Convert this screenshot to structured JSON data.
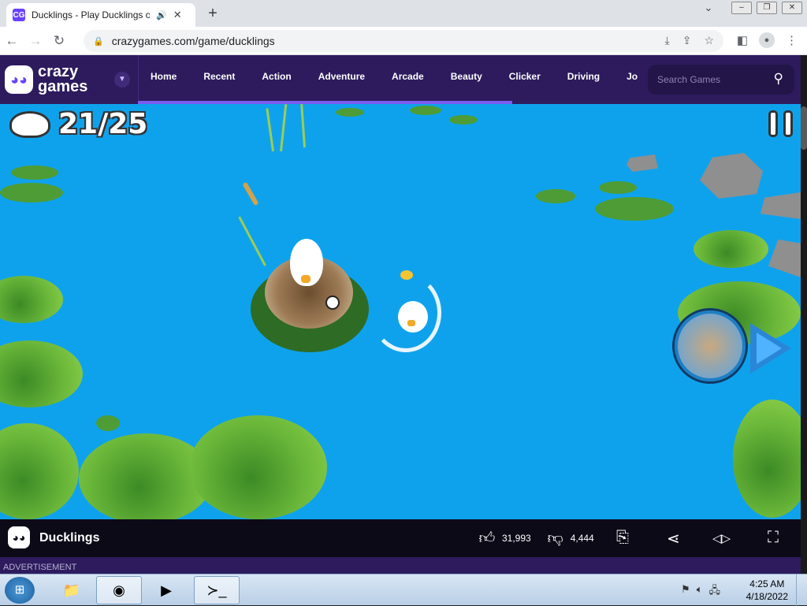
{
  "browser": {
    "tab_title": "Ducklings - Play Ducklings o",
    "tab_favicon": "CG",
    "tab_audio_icon": "speaker-icon",
    "tab_close": "✕",
    "new_tab": "+",
    "url": "crazygames.com/game/ducklings"
  },
  "site": {
    "logo_line1": "crazy",
    "logo_line2": "games",
    "nav": [
      "Home",
      "Recent",
      "Action",
      "Adventure",
      "Arcade",
      "Beauty",
      "Clicker",
      "Driving",
      "Jo"
    ],
    "search_placeholder": "Search Games",
    "colors": {
      "header_bg": "#2d1b5e",
      "accent": "#6842ff"
    }
  },
  "game": {
    "ducklings_count": "21/25",
    "water_color": "#0fa2ec"
  },
  "footer": {
    "title": "Ducklings",
    "likes": "31,993",
    "dislikes": "4,444",
    "advertisement": "ADVERTISEMENT"
  },
  "taskbar": {
    "time": "4:25 AM",
    "date": "4/18/2022"
  }
}
